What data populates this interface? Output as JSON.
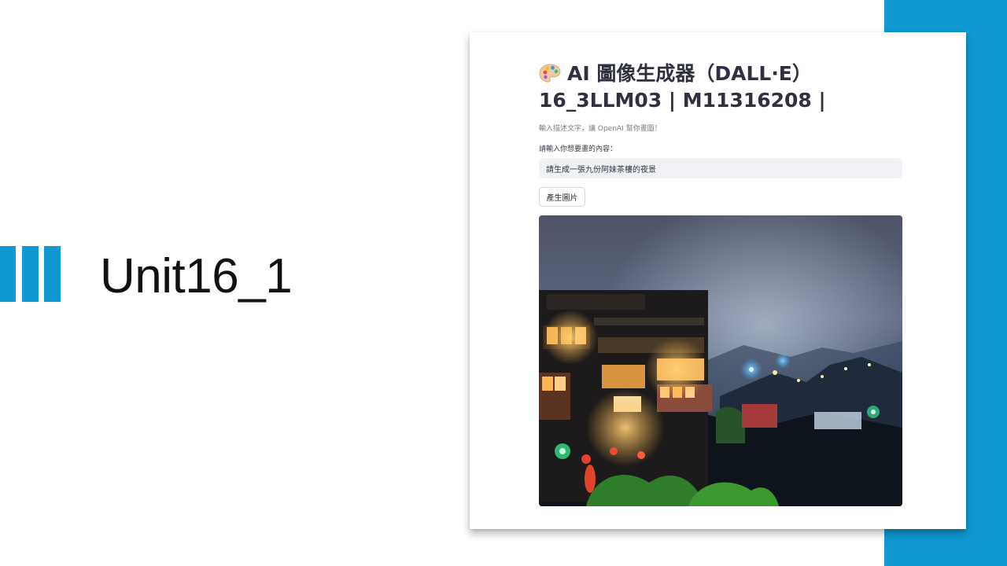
{
  "slide": {
    "title": "Unit16_1",
    "colors": {
      "accent": "#1098d2",
      "background": "#ffffff"
    }
  },
  "app": {
    "title_icon": "artist-palette-icon",
    "title_line1": "AI 圖像生成器（DALL·E）",
    "title_line2": "16_3LLM03 | M11316208 |",
    "caption": "輸入描述文字，讓 OpenAI 幫你畫圖！",
    "prompt_label": "請輸入你想要畫的內容：",
    "prompt_value": "請生成一張九份阿妹茶樓的夜景",
    "generate_button": "產生圖片",
    "image_subject": "jiufen-amei-teahouse-night-scene"
  }
}
